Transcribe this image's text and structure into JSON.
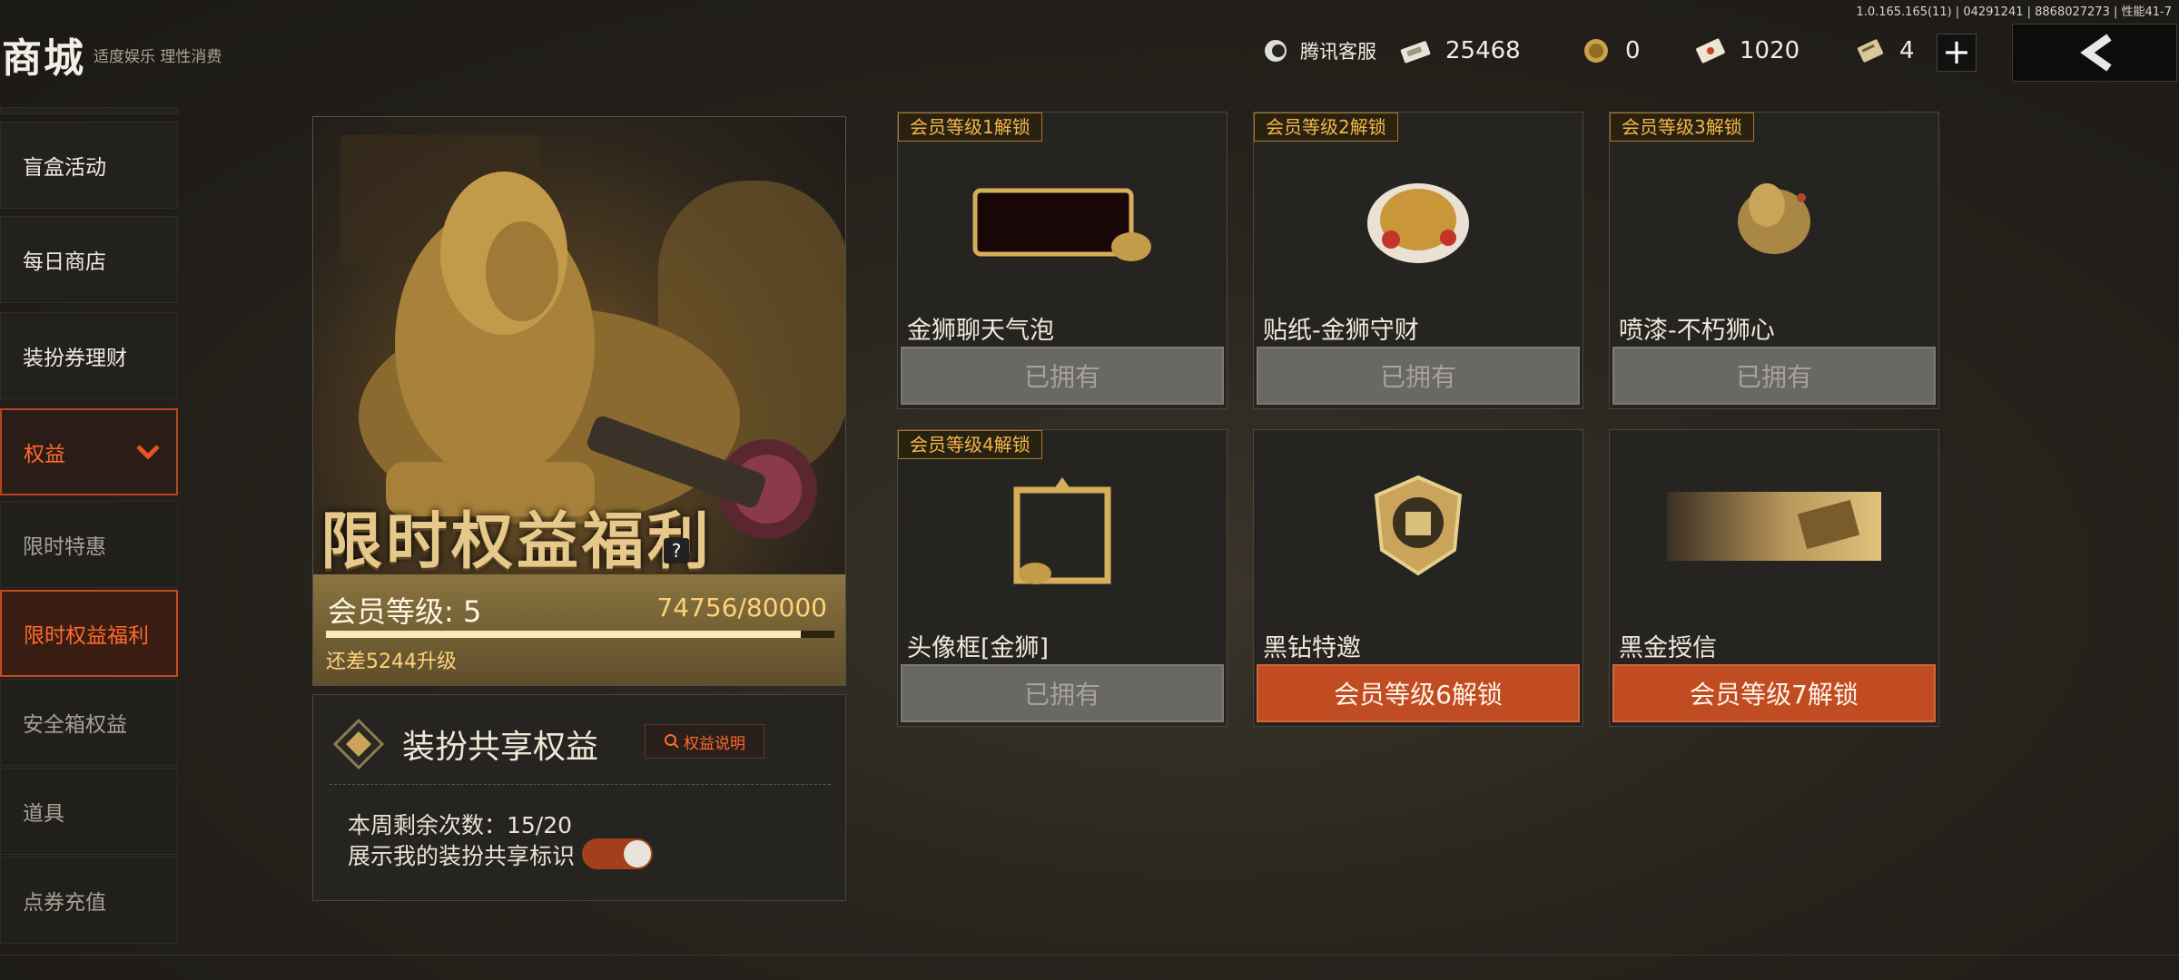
{
  "status": {
    "version": "1.0.165.165(11) | 04291241 | 8868027273 | 性能41-7"
  },
  "header": {
    "title": "商城",
    "subtitle": "适度娱乐 理性消费",
    "service_label": "腾讯客服",
    "currencies": [
      {
        "icon": "banknote-icon",
        "value": "25468"
      },
      {
        "icon": "gold-coin-icon",
        "value": "0"
      },
      {
        "icon": "coupon-icon",
        "value": "1020"
      },
      {
        "icon": "ticket-icon",
        "value": "4"
      }
    ],
    "plus_label": "+"
  },
  "sidebar": {
    "items": [
      {
        "label": "盲盒活动"
      },
      {
        "label": "每日商店"
      },
      {
        "label": "装扮券理财"
      },
      {
        "label": "权益"
      },
      {
        "label": "限时特惠"
      },
      {
        "label": "限时权益福利"
      },
      {
        "label": "安全箱权益"
      },
      {
        "label": "道具"
      },
      {
        "label": "点券充值"
      }
    ],
    "expanded_icon": "chevron-down-icon"
  },
  "feature": {
    "banner": "限时权益福利",
    "help": "?",
    "level_label": "会员等级: 5",
    "exp_text": "74756/80000",
    "exp_progress": 0.9345,
    "upgrade_hint": "还差5244升级"
  },
  "share": {
    "title": "装扮共享权益",
    "explain_button": "权益说明",
    "weekly_remaining": "本周剩余次数：15/20",
    "toggle_label": "展示我的装扮共享标识",
    "toggle_on": true
  },
  "items": [
    {
      "badge": "会员等级1解锁",
      "name": "金狮聊天气泡",
      "button": "已拥有",
      "state": "owned",
      "icon": "chat-bubble-icon"
    },
    {
      "badge": "会员等级2解锁",
      "name": "贴纸-金狮守财",
      "button": "已拥有",
      "state": "owned",
      "icon": "lion-sticker-icon"
    },
    {
      "badge": "会员等级3解锁",
      "name": "喷漆-不朽狮心",
      "button": "已拥有",
      "state": "owned",
      "icon": "lion-spray-icon"
    },
    {
      "badge": "会员等级4解锁",
      "name": "头像框[金狮]",
      "button": "已拥有",
      "state": "owned",
      "icon": "avatar-frame-icon"
    },
    {
      "badge": "",
      "name": "黑钻特邀",
      "button": "会员等级6解锁",
      "state": "locked",
      "icon": "helmet-badge-icon"
    },
    {
      "badge": "",
      "name": "黑金授信",
      "button": "会员等级7解锁",
      "state": "locked",
      "icon": "gold-banner-icon"
    }
  ],
  "colors": {
    "accent": "#c14c21",
    "gold": "#f4b64a",
    "owned_gray": "#6a6864"
  }
}
